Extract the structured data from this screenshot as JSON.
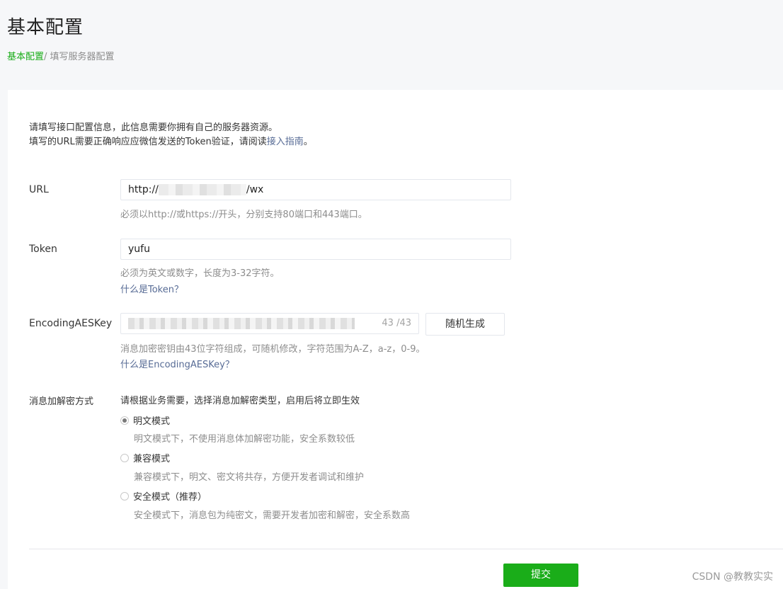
{
  "header": {
    "title": "基本配置",
    "breadcrumb_root": "基本配置",
    "breadcrumb_separator": "/",
    "breadcrumb_current": "填写服务器配置"
  },
  "intro": {
    "line1": "请填写接口配置信息，此信息需要你拥有自己的服务器资源。",
    "line2_prefix": "填写的URL需要正确响应应微信发送的Token验证，请阅读",
    "line2_link": "接入指南",
    "line2_suffix": "。"
  },
  "form": {
    "url": {
      "label": "URL",
      "value_prefix": "http://",
      "value_suffix": "/wx",
      "hint": "必须以http://或https://开头，分别支持80端口和443端口。"
    },
    "token": {
      "label": "Token",
      "value": "yufu",
      "hint": "必须为英文或数字，长度为3-32字符。",
      "help_link": "什么是Token？"
    },
    "aes": {
      "label": "EncodingAESKey",
      "counter": "43 /43",
      "random_button": "随机生成",
      "hint": "消息加密密钥由43位字符组成，可随机修改，字符范围为A-Z，a-z，0-9。",
      "help_link": "什么是EncodingAESKey？"
    },
    "encryption": {
      "label": "消息加解密方式",
      "description": "请根据业务需要，选择消息加解密类型，启用后将立即生效",
      "options": [
        {
          "label": "明文模式",
          "desc": "明文模式下，不使用消息体加解密功能，安全系数较低",
          "checked": true
        },
        {
          "label": "兼容模式",
          "desc": "兼容模式下，明文、密文将共存，方便开发者调试和维护",
          "checked": false
        },
        {
          "label": "安全模式（推荐）",
          "desc": "安全模式下，消息包为纯密文，需要开发者加密和解密，安全系数高",
          "checked": false
        }
      ]
    }
  },
  "submit_label": "提交",
  "watermark": "CSDN @教教实实",
  "colors": {
    "accent": "#1aad19",
    "link": "#576b95"
  }
}
